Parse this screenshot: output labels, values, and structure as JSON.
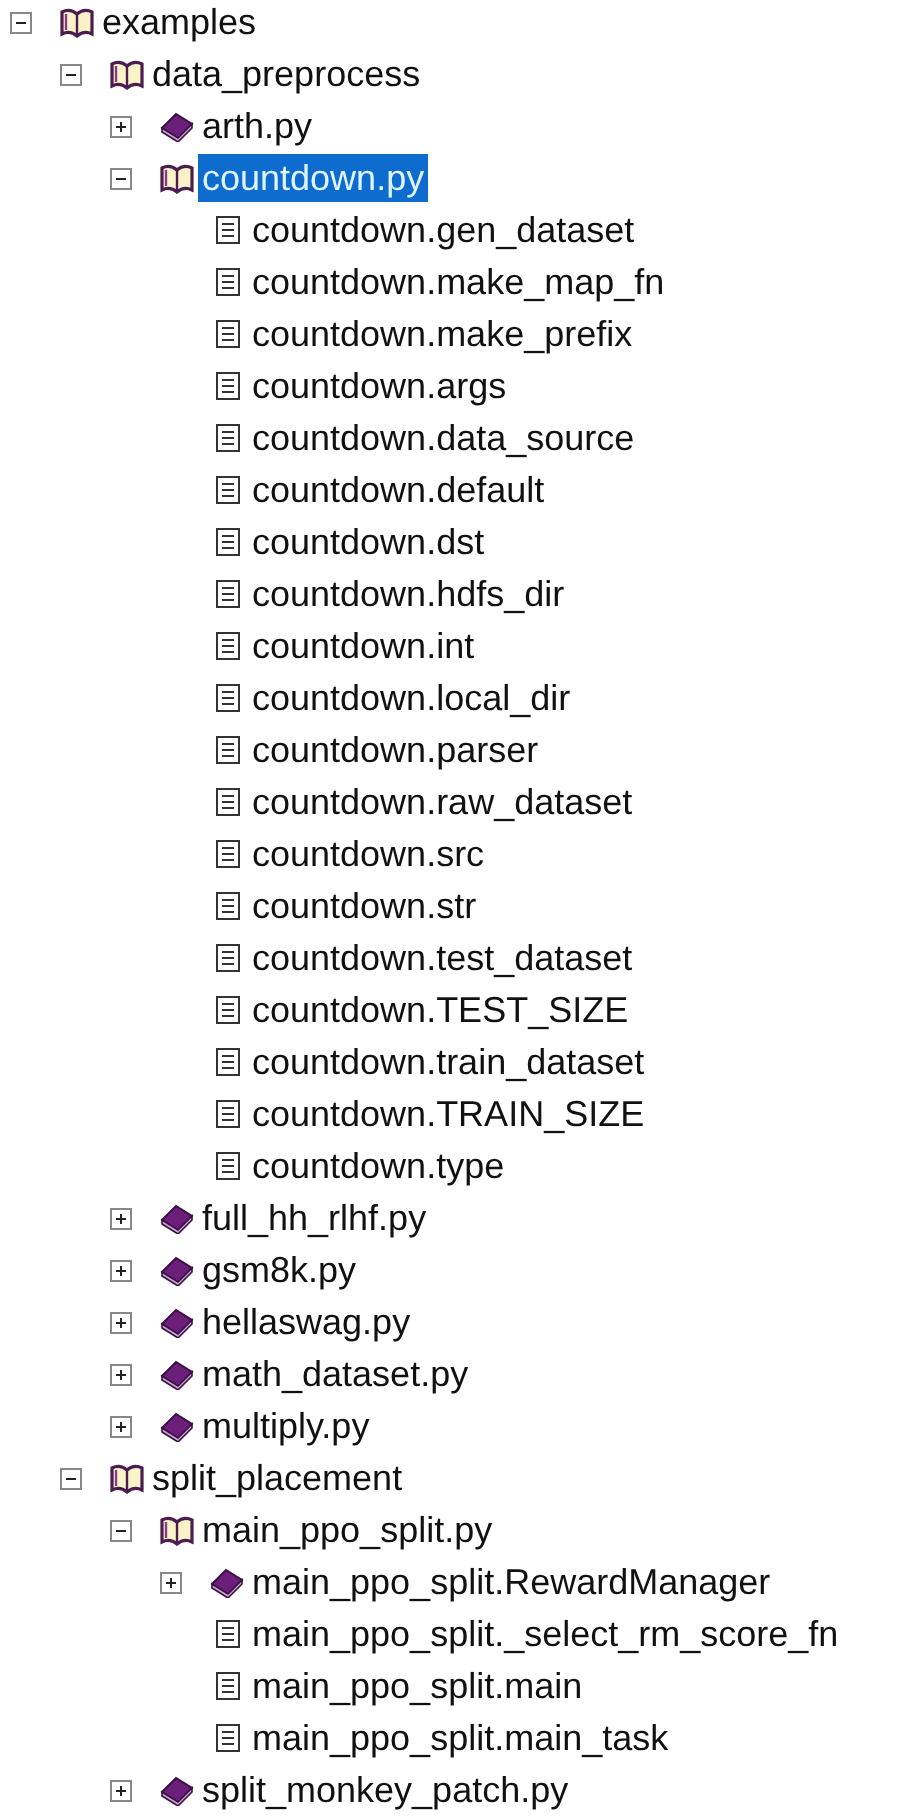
{
  "tree": [
    {
      "label": "examples",
      "kind": "node",
      "expanded": true,
      "selected": false,
      "children": [
        {
          "label": "data_preprocess",
          "kind": "node",
          "expanded": true,
          "selected": false,
          "children": [
            {
              "label": "arth.py",
              "kind": "node",
              "expanded": false,
              "selected": false
            },
            {
              "label": "countdown.py",
              "kind": "node",
              "expanded": true,
              "selected": true,
              "children": [
                {
                  "label": "countdown.gen_dataset",
                  "kind": "leaf",
                  "selected": false
                },
                {
                  "label": "countdown.make_map_fn",
                  "kind": "leaf",
                  "selected": false
                },
                {
                  "label": "countdown.make_prefix",
                  "kind": "leaf",
                  "selected": false
                },
                {
                  "label": "countdown.args",
                  "kind": "leaf",
                  "selected": false
                },
                {
                  "label": "countdown.data_source",
                  "kind": "leaf",
                  "selected": false
                },
                {
                  "label": "countdown.default",
                  "kind": "leaf",
                  "selected": false
                },
                {
                  "label": "countdown.dst",
                  "kind": "leaf",
                  "selected": false
                },
                {
                  "label": "countdown.hdfs_dir",
                  "kind": "leaf",
                  "selected": false
                },
                {
                  "label": "countdown.int",
                  "kind": "leaf",
                  "selected": false
                },
                {
                  "label": "countdown.local_dir",
                  "kind": "leaf",
                  "selected": false
                },
                {
                  "label": "countdown.parser",
                  "kind": "leaf",
                  "selected": false
                },
                {
                  "label": "countdown.raw_dataset",
                  "kind": "leaf",
                  "selected": false
                },
                {
                  "label": "countdown.src",
                  "kind": "leaf",
                  "selected": false
                },
                {
                  "label": "countdown.str",
                  "kind": "leaf",
                  "selected": false
                },
                {
                  "label": "countdown.test_dataset",
                  "kind": "leaf",
                  "selected": false
                },
                {
                  "label": "countdown.TEST_SIZE",
                  "kind": "leaf",
                  "selected": false
                },
                {
                  "label": "countdown.train_dataset",
                  "kind": "leaf",
                  "selected": false
                },
                {
                  "label": "countdown.TRAIN_SIZE",
                  "kind": "leaf",
                  "selected": false
                },
                {
                  "label": "countdown.type",
                  "kind": "leaf",
                  "selected": false
                }
              ]
            },
            {
              "label": "full_hh_rlhf.py",
              "kind": "node",
              "expanded": false,
              "selected": false
            },
            {
              "label": "gsm8k.py",
              "kind": "node",
              "expanded": false,
              "selected": false
            },
            {
              "label": "hellaswag.py",
              "kind": "node",
              "expanded": false,
              "selected": false
            },
            {
              "label": "math_dataset.py",
              "kind": "node",
              "expanded": false,
              "selected": false
            },
            {
              "label": "multiply.py",
              "kind": "node",
              "expanded": false,
              "selected": false
            }
          ]
        },
        {
          "label": "split_placement",
          "kind": "node",
          "expanded": true,
          "selected": false,
          "children": [
            {
              "label": "main_ppo_split.py",
              "kind": "node",
              "expanded": true,
              "selected": false,
              "children": [
                {
                  "label": "main_ppo_split.RewardManager",
                  "kind": "node",
                  "expanded": false,
                  "selected": false
                },
                {
                  "label": "main_ppo_split._select_rm_score_fn",
                  "kind": "leaf",
                  "selected": false
                },
                {
                  "label": "main_ppo_split.main",
                  "kind": "leaf",
                  "selected": false
                },
                {
                  "label": "main_ppo_split.main_task",
                  "kind": "leaf",
                  "selected": false
                }
              ]
            },
            {
              "label": "split_monkey_patch.py",
              "kind": "node",
              "expanded": false,
              "selected": false
            }
          ]
        }
      ]
    }
  ]
}
